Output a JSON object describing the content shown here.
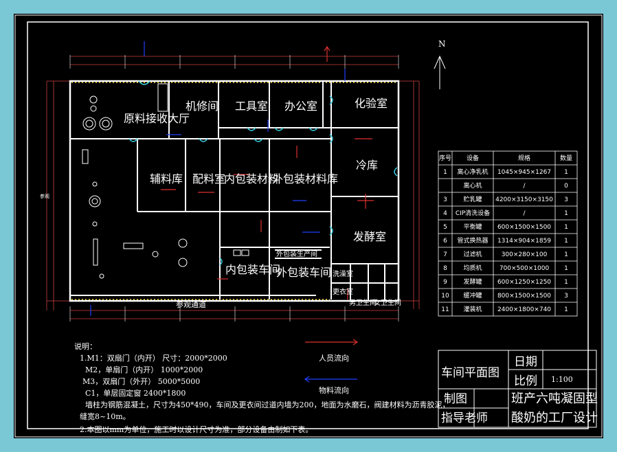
{
  "north": "N",
  "rooms": {
    "raw": "原料接收大厅",
    "repair": "机修间",
    "tool": "工具室",
    "office": "办公室",
    "lab": "化验室",
    "aux": "辅料库",
    "mix": "配料室",
    "inner_mat": "内包装材料",
    "outer_mat": "外包装材料库",
    "cold": "冷库",
    "ferment": "发酵室",
    "inner_ws": "内包装车间",
    "outer_ws": "外包装车间",
    "outer_prod": "外包装生产间",
    "corridor": "参观通道",
    "wash": "洗澡室",
    "locker": "更衣室",
    "toilet_m": "男卫生间",
    "toilet_f": "女卫生间",
    "side_left": "参观"
  },
  "equipment_table": {
    "headers": [
      "序号",
      "设备",
      "规格",
      "数量"
    ],
    "rows": [
      [
        "1",
        "离心净乳机",
        "1045×945×1267",
        "1"
      ],
      [
        "",
        "离心机",
        "/",
        "0"
      ],
      [
        "3",
        "贮乳罐",
        "4200×3150×3150",
        "3"
      ],
      [
        "4",
        "CIP清洗设备",
        "/",
        "1"
      ],
      [
        "5",
        "平衡罐",
        "600×1500×1500",
        "1"
      ],
      [
        "6",
        "管式换热器",
        "1314×904×1859",
        "1"
      ],
      [
        "7",
        "过滤机",
        "300×280×100",
        "1"
      ],
      [
        "8",
        "均质机",
        "700×500×1000",
        "1"
      ],
      [
        "9",
        "发酵罐",
        "600×1250×1250",
        "1"
      ],
      [
        "10",
        "缓冲罐",
        "800×1500×1500",
        "3"
      ],
      [
        "11",
        "灌装机",
        "2400×1800×740",
        "1"
      ]
    ]
  },
  "legend": {
    "people": "人员流向",
    "material": "物料流向",
    "people_color": "#e03030",
    "material_color": "#2040ff"
  },
  "notes": {
    "title": "说明：",
    "lines": [
      "1.M1：双扇门（内开）          尺寸：2000*2000",
      "M2，单扇门（内开）              1000*2000",
      "M3，双扇门（外开）            5000*5000",
      "C1，单层固定窗                 2400*1800",
      "墙柱为钢筋混凝土，尺寸为450*490，车间及更衣间过道内墙为200，地面为水磨石，阀建材料为沥青胶泥，",
      "缝宽8~10m。",
      "2.本图以mm为单位，施工时以设计尺寸为准，部分设备由制如下表。"
    ]
  },
  "title_block": {
    "drawing_name": "车间平面图",
    "date_label": "日期",
    "scale_label": "比例",
    "scale_value": "1:100",
    "drafter_label": "制图",
    "teacher_label": "指导老师",
    "project_title_1": "班产六吨凝固型",
    "project_title_2": "酸奶的工厂设计"
  }
}
